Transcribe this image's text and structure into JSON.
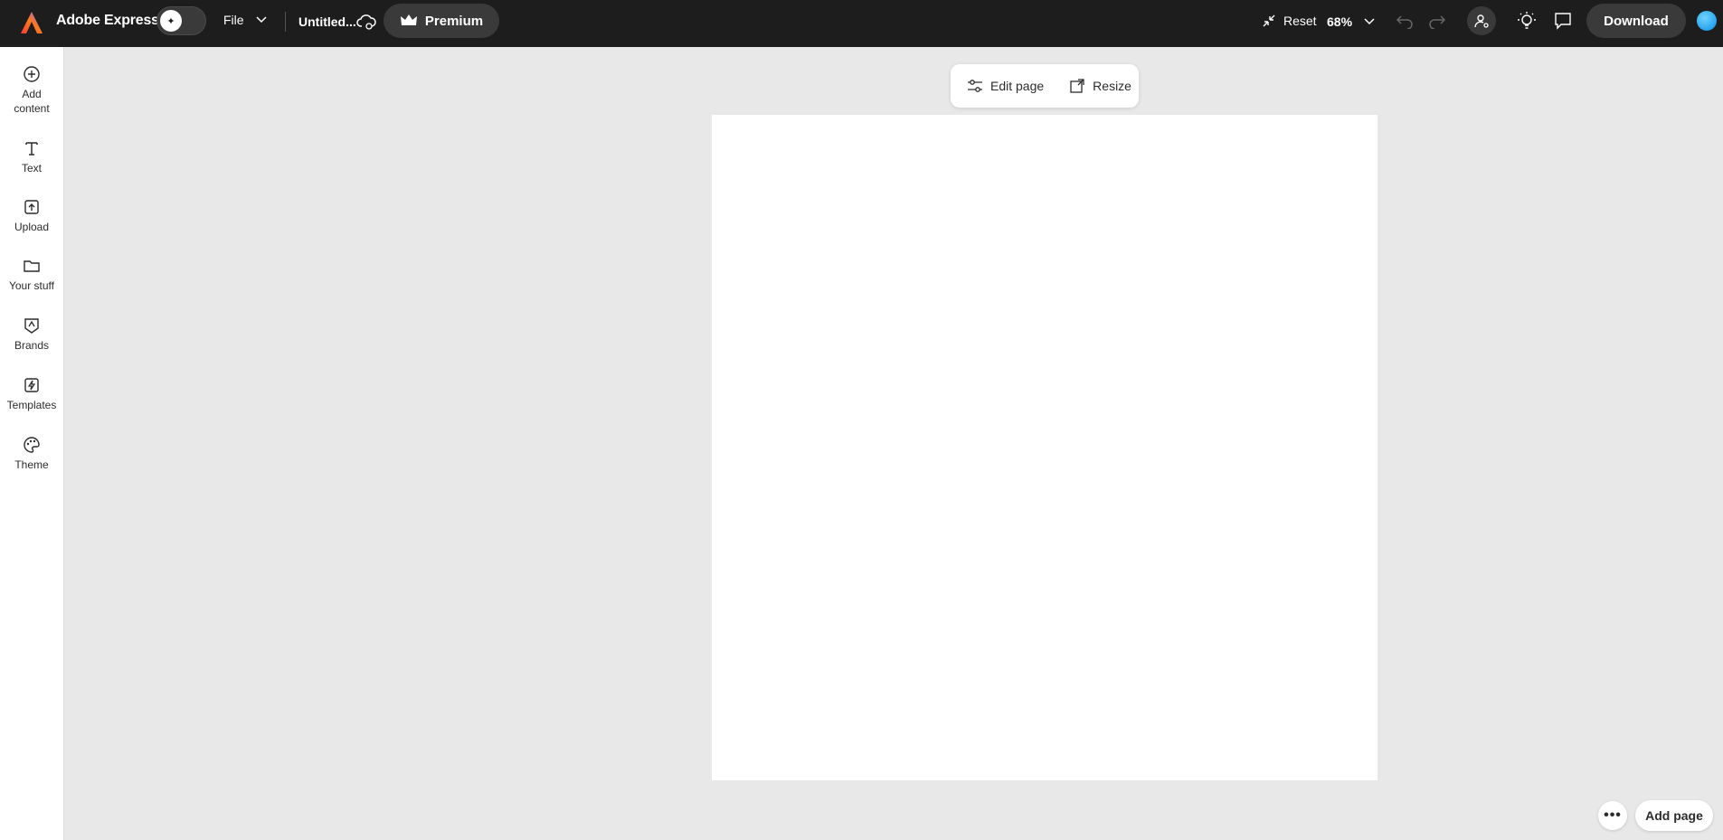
{
  "header": {
    "app_name": "Adobe Express",
    "file_label": "File",
    "doc_title": "Untitled...",
    "premium_label": "Premium",
    "reset_label": "Reset",
    "zoom": "68%",
    "download_label": "Download"
  },
  "sidebar": {
    "items": [
      {
        "label_line1": "Add",
        "label_line2": "content",
        "icon": "plus-circle-icon"
      },
      {
        "label_line1": "Text",
        "label_line2": "",
        "icon": "text-icon"
      },
      {
        "label_line1": "Upload",
        "label_line2": "",
        "icon": "upload-icon"
      },
      {
        "label_line1": "Your stuff",
        "label_line2": "",
        "icon": "folder-icon"
      },
      {
        "label_line1": "Brands",
        "label_line2": "",
        "icon": "brand-icon"
      },
      {
        "label_line1": "Templates",
        "label_line2": "",
        "icon": "templates-icon"
      },
      {
        "label_line1": "Theme",
        "label_line2": "",
        "icon": "palette-icon"
      }
    ]
  },
  "canvas": {
    "edit_page_label": "Edit page",
    "resize_label": "Resize",
    "more_label": "•••",
    "add_page_label": "Add page"
  },
  "colors": {
    "topbar": "#1d1d1d",
    "canvas_bg": "#e8e8e8",
    "page_bg": "#ffffff"
  }
}
